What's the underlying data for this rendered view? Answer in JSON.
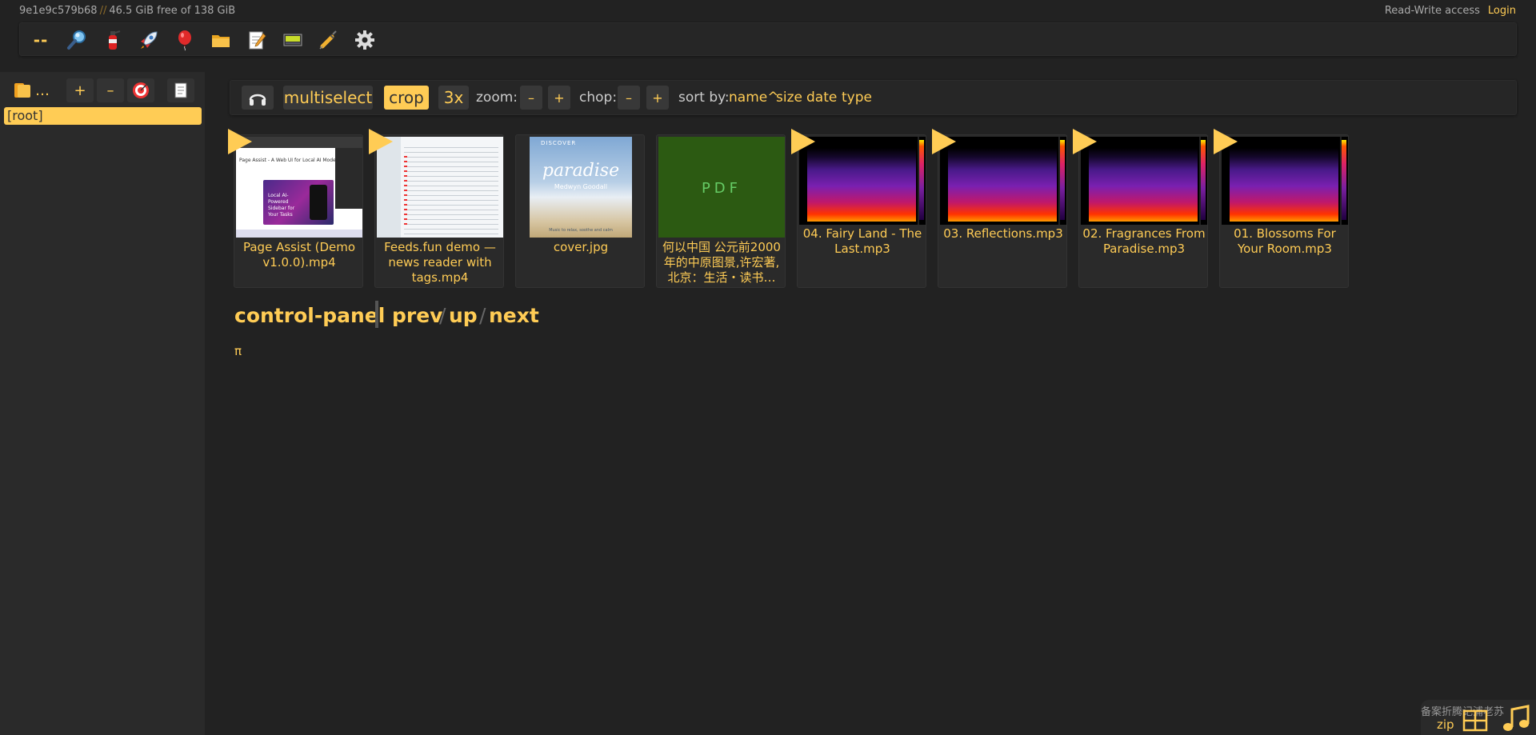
{
  "status": {
    "host_id": "9e1e9c579b68",
    "separator": "//",
    "free_space": "46.5 GiB free of 138 GiB",
    "access": "Read-Write access",
    "login": "Login"
  },
  "toolbar": {
    "items": [
      {
        "name": "bup-button",
        "label": "--",
        "icon": "dash-text"
      },
      {
        "name": "search-button",
        "icon": "magnifier-icon"
      },
      {
        "name": "unpost-button",
        "icon": "fire-extinguisher-icon"
      },
      {
        "name": "upload-button",
        "icon": "rocket-icon"
      },
      {
        "name": "mkdir-button",
        "icon": "balloon-icon"
      },
      {
        "name": "new-folder-button",
        "icon": "folder-icon"
      },
      {
        "name": "new-file-button",
        "icon": "notepad-icon"
      },
      {
        "name": "message-button",
        "icon": "display-icon"
      },
      {
        "name": "cut-button",
        "icon": "syringe-icon"
      },
      {
        "name": "settings-button",
        "icon": "gear-icon"
      }
    ]
  },
  "tree": {
    "ellipsis": "…",
    "plus": "+",
    "minus": "–",
    "root": "[root]"
  },
  "opa": {
    "multiselect": "multiselect",
    "crop": "crop",
    "scale": "3x",
    "zoom_label": "zoom:",
    "minus": "–",
    "plus": "+",
    "chop_label": "chop:",
    "sort_label": "sort by:",
    "sort_name": "name^",
    "sort_size": "size",
    "sort_date": "date",
    "sort_type": "type"
  },
  "files": [
    {
      "name": "Page Assist (Demo v1.0.0).mp4",
      "kind": "video",
      "preview_title": "Page Assist - A Web UI for Local AI Models",
      "preview_card": "Local AI-Powered Sidebar for Your Tasks"
    },
    {
      "name": "Feeds.fun demo — news reader with tags.mp4",
      "kind": "video"
    },
    {
      "name": "cover.jpg",
      "kind": "image",
      "cover_top": "DISCOVER",
      "cover_title": "paradise",
      "cover_artist": "Medwyn Goodall",
      "cover_sub": "Music to relax, soothe and calm"
    },
    {
      "name": "何以中国 公元前2000年的中原图景,许宏著,北京：生活・读书…",
      "kind": "pdf",
      "badge": "PDF"
    },
    {
      "name": "04. Fairy Land - The Last.mp3",
      "kind": "audio"
    },
    {
      "name": "03. Reflections.mp3",
      "kind": "audio"
    },
    {
      "name": "02. Fragrances From Paradise.mp3",
      "kind": "audio"
    },
    {
      "name": "01. Blossoms For Your Room.mp3",
      "kind": "audio"
    }
  ],
  "path": {
    "current": "control-panel",
    "prev": "prev",
    "up": "up",
    "next": "next",
    "slash": "/"
  },
  "pi": "π",
  "bottom": {
    "overlay": "备案折腾记浦老苏",
    "zip": "zip"
  },
  "colors": {
    "accent": "#ffcc55",
    "background": "#222222",
    "panel": "#2a2a2a",
    "pdf_green": "#2c5a12"
  }
}
